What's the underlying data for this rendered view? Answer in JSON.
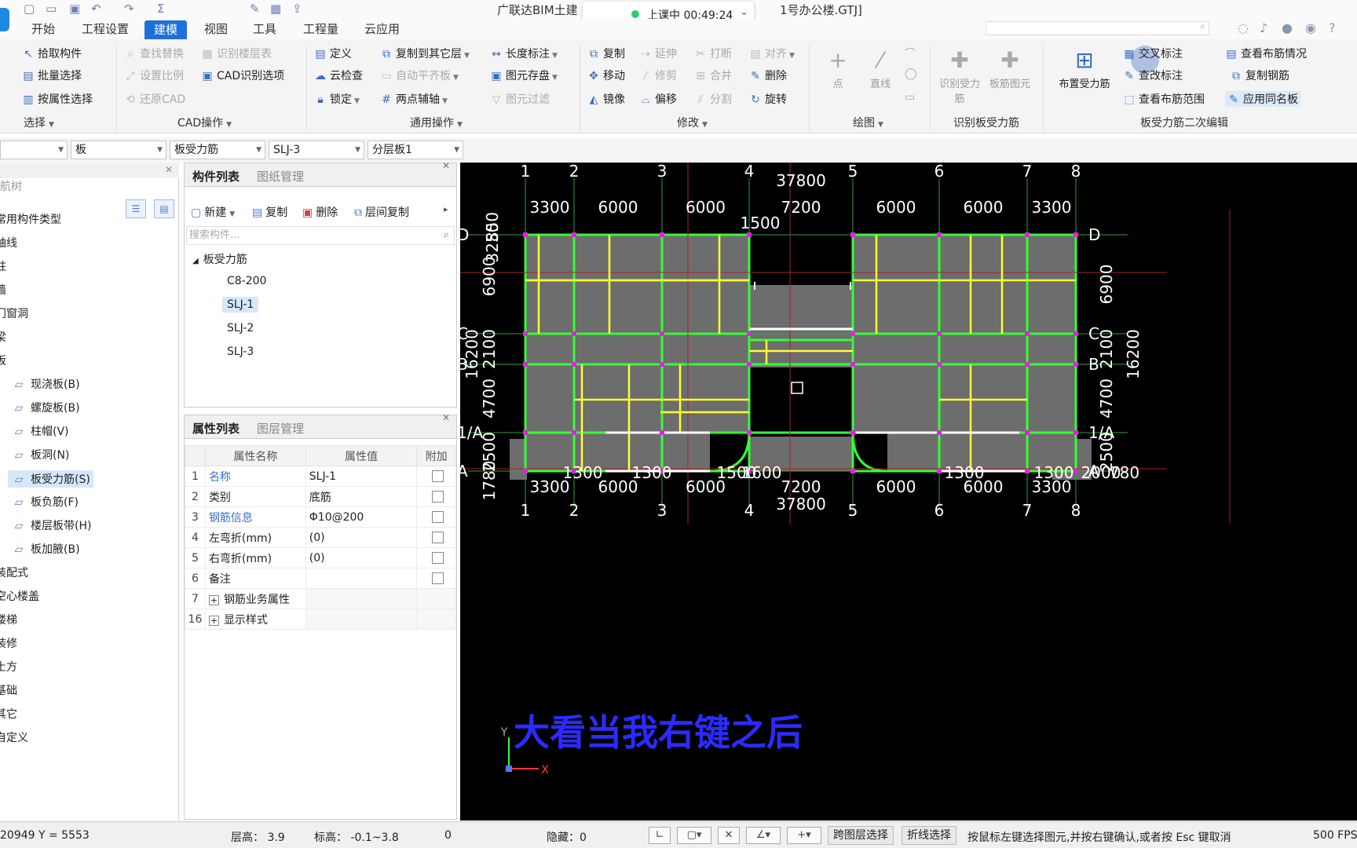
{
  "title": {
    "app": "广联达BIM土建",
    "file": "1号办公楼.GTJ]"
  },
  "live": {
    "label": "上课中 00:49:24"
  },
  "menu": [
    "开始",
    "工程设置",
    "建模",
    "视图",
    "工具",
    "工程量",
    "云应用"
  ],
  "ribbon": {
    "select_group": {
      "pick": "拾取构件",
      "batch": "批量选择",
      "by_attr": "按属性选择",
      "label": "选择"
    },
    "cad_group": {
      "find_replace": "查找替换",
      "id_floor": "识别楼层表",
      "set_scale": "设置比例",
      "cad_options": "CAD识别选项",
      "restore": "还原CAD",
      "label": "CAD操作"
    },
    "common_group": {
      "define": "定义",
      "copy_to_floor": "复制到其它层",
      "length_dim": "长度标注",
      "cloud_check": "云检查",
      "auto_flat": "自动平齐板",
      "save_elem": "图元存盘",
      "lock": "锁定",
      "two_point_axis": "两点辅轴",
      "elem_filter": "图元过滤",
      "label": "通用操作"
    },
    "modify_group": {
      "copy": "复制",
      "extend": "延伸",
      "break": "打断",
      "align": "对齐",
      "move": "移动",
      "trim": "修剪",
      "merge": "合并",
      "delete": "删除",
      "mirror": "镜像",
      "offset": "偏移",
      "split": "分割",
      "rotate": "旋转",
      "label": "修改"
    },
    "draw_group": {
      "point": "点",
      "line": "直线",
      "label": "绘图"
    },
    "identify_group": {
      "id_rebar": "识别受力筋",
      "board_rebar": "板筋图元",
      "label": "识别板受力筋"
    },
    "edit_group": {
      "place_rebar": "布置受力筋",
      "cross_mark": "交叉标注",
      "view_rebar_style": "查看布筋情况",
      "view_mark": "查改标注",
      "copy_rebar": "复制钢筋",
      "view_range": "查看布筋范围",
      "apply_same": "应用同名板",
      "label": "板受力筋二次编辑"
    }
  },
  "selectors": [
    "",
    "板",
    "板受力筋",
    "SLJ-3",
    "分层板1"
  ],
  "tree": {
    "header": "导航树",
    "items": [
      "常用构件类型",
      "轴线",
      "柱",
      "墙",
      "门窗洞",
      "梁",
      "板",
      "现浇板(B)",
      "螺旋板(B)",
      "柱帽(V)",
      "板洞(N)",
      "板受力筋(S)",
      "板负筋(F)",
      "楼层板带(H)",
      "板加腋(B)",
      "装配式",
      "空心楼盖",
      "楼梯",
      "装修",
      "土方",
      "基础",
      "其它",
      "自定义"
    ],
    "icons": [
      "slab-icon",
      "spiral-slab-icon",
      "column-cap-icon",
      "slab-hole-icon",
      "rebar-icon",
      "neg-rebar-icon",
      "band-icon",
      "haunch-icon"
    ]
  },
  "component_list": {
    "tabs": [
      "构件列表",
      "图纸管理"
    ],
    "toolbar": {
      "new": "新建",
      "copy": "复制",
      "delete": "删除",
      "floor_copy": "层间复制"
    },
    "search_placeholder": "搜索构件...",
    "root": "板受力筋",
    "items": [
      "C8-200",
      "SLJ-1",
      "SLJ-2",
      "SLJ-3"
    ]
  },
  "properties": {
    "tabs": [
      "属性列表",
      "图层管理"
    ],
    "headers": [
      "属性名称",
      "属性值",
      "附加"
    ],
    "rows": [
      {
        "idx": "1",
        "name": "名称",
        "value": "SLJ-1"
      },
      {
        "idx": "2",
        "name": "类别",
        "value": "底筋"
      },
      {
        "idx": "3",
        "name": "钢筋信息",
        "value": "Φ10@200"
      },
      {
        "idx": "4",
        "name": "左弯折(mm)",
        "value": "(0)"
      },
      {
        "idx": "5",
        "name": "右弯折(mm)",
        "value": "(0)"
      },
      {
        "idx": "6",
        "name": "备注",
        "value": ""
      },
      {
        "idx": "7",
        "name": "钢筋业务属性",
        "value": ""
      },
      {
        "idx": "16",
        "name": "显示样式",
        "value": ""
      }
    ]
  },
  "drawing": {
    "axes_x": [
      "1",
      "2",
      "3",
      "4",
      "5",
      "6",
      "7",
      "8"
    ],
    "axes_y": [
      "D",
      "C",
      "B",
      "1/A",
      "A"
    ],
    "total_width": "37800",
    "top_dims": [
      "3300",
      "6000",
      "6000",
      "7200",
      "6000",
      "6000",
      "3300"
    ],
    "top_sub_dim": "1500",
    "bottom_dims": [
      "3300",
      "6000",
      "6000",
      "7200",
      "6000",
      "6000",
      "3300"
    ],
    "bottom_sub_dims": [
      "1300",
      "1300",
      "1500",
      "1600",
      "1300",
      "1300",
      "2000",
      "780"
    ],
    "right_dims": [
      "6900",
      "2100",
      "4700",
      "2500"
    ],
    "right_total": "16200",
    "left_dims": [
      "850",
      "3250",
      "6900",
      "2100",
      "4700",
      "2500",
      "1780"
    ],
    "left_total": "16200",
    "caption": "大看当我右键之后",
    "ucs": {
      "y": "Y",
      "x": "X"
    }
  },
  "status": {
    "coords": "20949 Y = 5553",
    "floor_height": "层高： 3.9",
    "elevation": "标高： -0.1~3.8",
    "zero": "0",
    "hidden": "隐藏：0",
    "cross_floor": "跨图层选择",
    "polyline": "折线选择",
    "hint": "按鼠标左键选择图元,并按右键确认,或者按 Esc 键取消",
    "fps": "500 FPS"
  },
  "colors": {
    "accent": "#1e6fd9",
    "canvas": "#000000",
    "rebar": "#ffff33",
    "beam": "#33ff33",
    "caption": "#2b2bff"
  }
}
